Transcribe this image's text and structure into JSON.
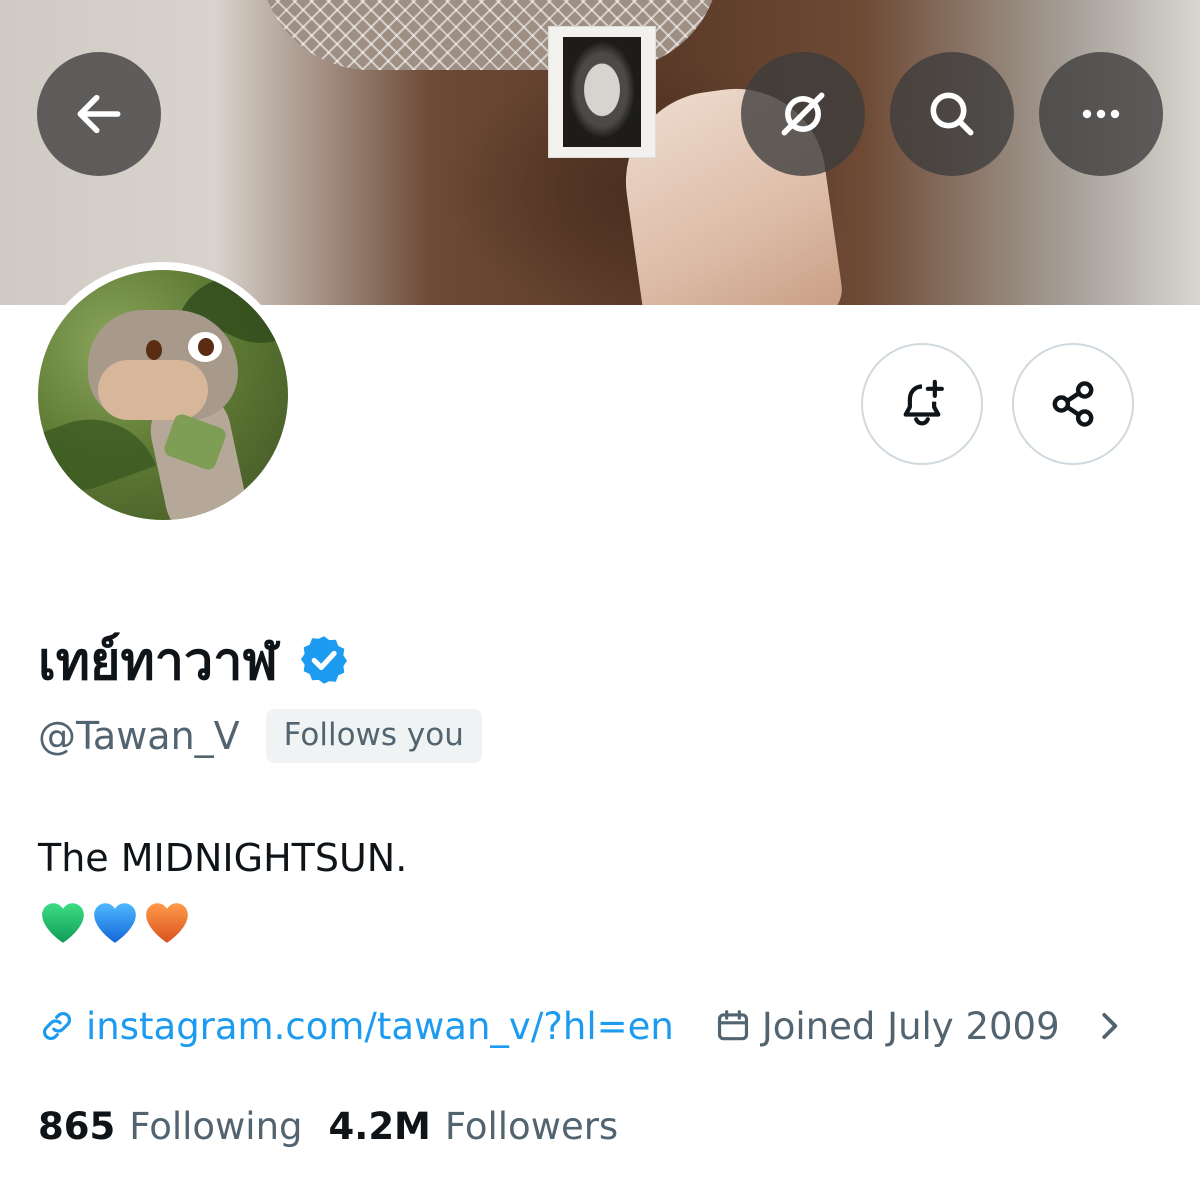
{
  "header": {
    "back_icon": "arrow-left-icon",
    "grok_icon": "grok-icon",
    "search_icon": "search-icon",
    "more_icon": "more-horizontal-icon"
  },
  "actions": {
    "notify_icon": "bell-plus-icon",
    "share_icon": "share-icon"
  },
  "profile": {
    "display_name": "เทย์ทาวาฬ",
    "verified": true,
    "handle": "@Tawan_V",
    "follows_you": "Follows you",
    "bio_line1": "The MIDNIGHTSUN.",
    "bio_hearts": [
      "green-heart",
      "blue-heart",
      "orange-heart"
    ],
    "website": "instagram.com/tawan_v/?hl=en",
    "joined": "Joined July 2009",
    "following_count": "865",
    "following_label": "Following",
    "followers_count": "4.2M",
    "followers_label": "Followers"
  },
  "colors": {
    "accent": "#1d9bf0",
    "secondary_text": "#536471",
    "primary_text": "#0f1419",
    "badge_bg": "#eff3f4",
    "verified_blue": "#1d9bf0",
    "heart_green": "#19b36b",
    "heart_blue": "#1da1f2",
    "heart_orange": "#f07a2c"
  }
}
